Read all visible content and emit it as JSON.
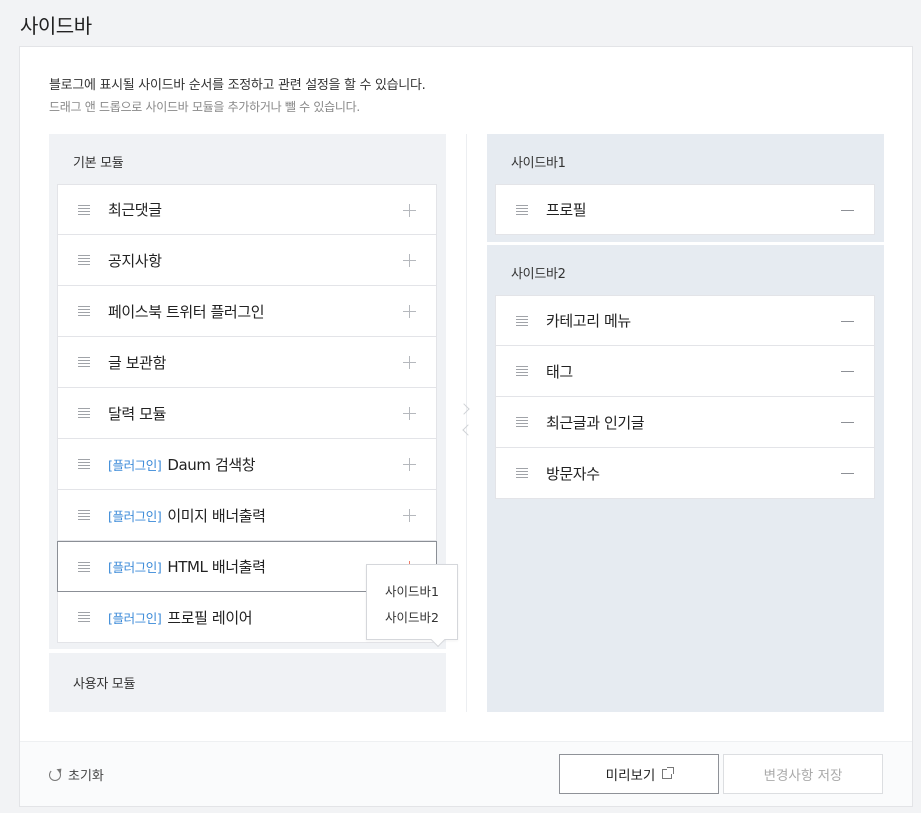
{
  "page": {
    "title": "사이드바"
  },
  "description": {
    "line1": "블로그에 표시될 사이드바 순서를 조정하고 관련 설정을 할 수 있습니다.",
    "line2": "드래그 앤 드롭으로 사이드바 모듈을 추가하거나 뺄 수 있습니다."
  },
  "basic_modules": {
    "title": "기본 모듈",
    "items": [
      {
        "tag": "",
        "label": "최근댓글"
      },
      {
        "tag": "",
        "label": "공지사항"
      },
      {
        "tag": "",
        "label": "페이스북 트위터 플러그인"
      },
      {
        "tag": "",
        "label": "글 보관함"
      },
      {
        "tag": "",
        "label": "달력 모듈"
      },
      {
        "tag": "[플러그인]",
        "label": "Daum 검색창"
      },
      {
        "tag": "[플러그인]",
        "label": "이미지 배너출력"
      },
      {
        "tag": "[플러그인]",
        "label": "HTML 배너출력"
      },
      {
        "tag": "[플러그인]",
        "label": "프로필 레이어"
      }
    ]
  },
  "user_modules": {
    "title": "사용자 모듈"
  },
  "popup": {
    "items": [
      "사이드바1",
      "사이드바2"
    ]
  },
  "sidebar1": {
    "title": "사이드바1",
    "items": [
      "프로필"
    ]
  },
  "sidebar2": {
    "title": "사이드바2",
    "items": [
      "카테고리 메뉴",
      "태그",
      "최근글과 인기글",
      "방문자수"
    ]
  },
  "footer": {
    "reset_label": "초기화",
    "preview_label": "미리보기",
    "save_label": "변경사항 저장"
  },
  "colors": {
    "plugin_tag": "#3b8ad8",
    "active_plus": "#f07c68",
    "sidebar_bg": "#e6ebf1",
    "module_bg": "#f0f2f5"
  },
  "icons": {
    "drag": "drag-handle-icon",
    "add": "plus-icon",
    "remove": "minus-icon",
    "reset": "refresh-icon",
    "external": "external-link-icon"
  }
}
